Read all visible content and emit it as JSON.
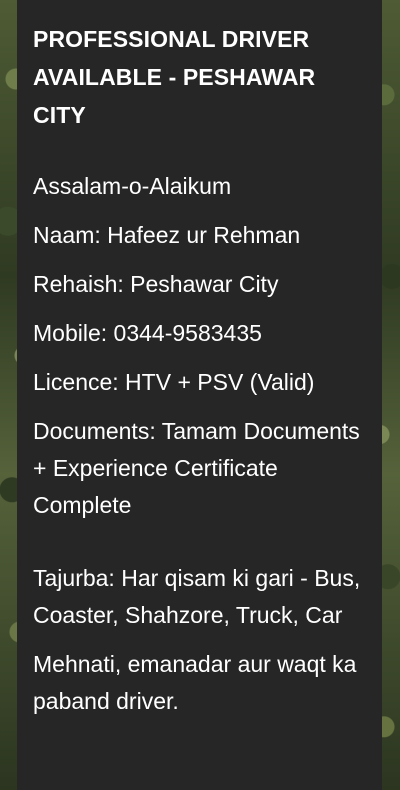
{
  "post": {
    "title": "PROFESSIONAL DRIVER AVAILABLE - PESHAWAR CITY",
    "greeting": "Assalam-o-Alaikum",
    "name": "Naam: Hafeez ur Rehman",
    "residence": "Rehaish: Peshawar City",
    "mobile": "Mobile: 0344-9583435",
    "licence": "Licence: HTV + PSV (Valid)",
    "documents": "Documents: Tamam Documents + Experience Certificate Complete",
    "experience": "Tajurba: Har qisam ki gari - Bus, Coaster, Shahzore, Truck, Car",
    "qualities": "Mehnati, emanadar aur waqt ka paband driver."
  }
}
